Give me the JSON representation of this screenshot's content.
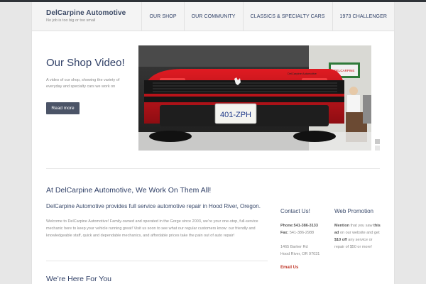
{
  "site": {
    "name": "DelCarpine Automotive",
    "tagline": "No job is too big or too small"
  },
  "nav": [
    "Our Shop",
    "Our Community",
    "Classics & Specialty Cars",
    "1973 Challenger"
  ],
  "hero": {
    "title": "Our Shop Video!",
    "text": "A video of our shop, showing the variety of everyday and specialty cars we work on",
    "button": "Read more",
    "plate": "401-ZPH",
    "sign": "DELCARPINE"
  },
  "main": {
    "heading": "At DelCarpine Automotive, We Work On Them All!",
    "subheading": "DelCarpine Automotive provides full service automotive repair in Hood River, Oregon.",
    "paragraph": "Welcome to DelCarpine Automotive! Family-owned and operated in the Gorge since 2003, we’re your one-stop, full-service mechanic here to keep your vehicle running great! Visit us soon to see what our regular customers know: our friendly and knowledgeable staff, quick and dependable mechanics, and affordable prices take the pain out of auto repair!",
    "second_heading": "We’re Here For You"
  },
  "contact": {
    "heading": "Contact Us!",
    "phone_label": "Phone:",
    "phone": "541-386-3133",
    "fax_label": "Fax:",
    "fax": "541-386-2988",
    "address1": "1465 Barker Rd",
    "address2": "Hood River, OR 97031",
    "email": "Email Us"
  },
  "promo": {
    "heading": "Web Promotion",
    "mention": "Mention",
    "text1": " that you saw ",
    "this_ad": "this ad",
    "text2": " on our website and get ",
    "discount": "$10 off",
    "text3": " any service or repair of $50 or more!"
  },
  "colors": {
    "heading": "#2f3f66",
    "button": "#4b5467",
    "email": "#c0392b",
    "car": "#c8141a"
  }
}
